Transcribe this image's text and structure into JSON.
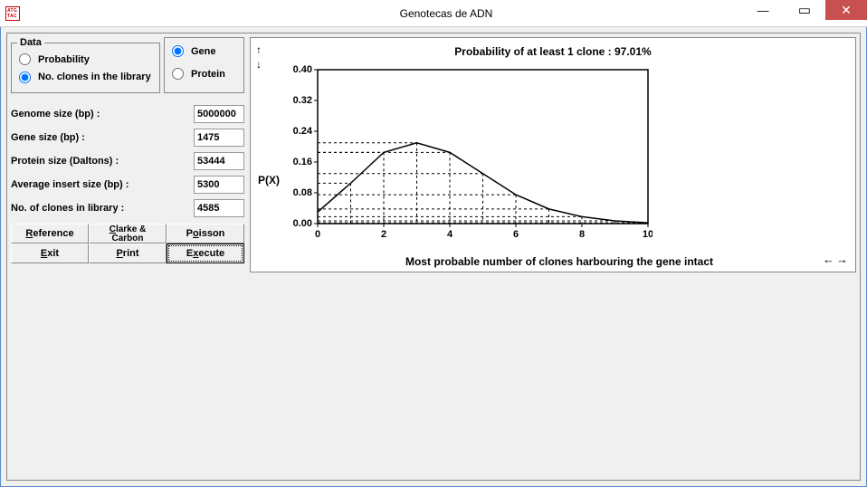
{
  "window": {
    "title": "Genotecas de ADN"
  },
  "data_group": {
    "legend": "Data",
    "opt_probability": "Probability",
    "opt_no_clones": "No.  clones in the library",
    "opt_gene": "Gene",
    "opt_protein": "Protein",
    "selected_left": "no_clones",
    "selected_right": "gene"
  },
  "fields": {
    "genome_size": {
      "label": "Genome size (bp) :",
      "value": "5000000"
    },
    "gene_size": {
      "label": "Gene size (bp) :",
      "value": "1475"
    },
    "protein_size": {
      "label": "Protein size (Daltons) :",
      "value": "53444"
    },
    "avg_insert": {
      "label": "Average insert size (bp) :",
      "value": "5300"
    },
    "no_clones": {
      "label": "No. of clones in library :",
      "value": "4585"
    }
  },
  "buttons": {
    "reference": "Reference",
    "clarke_carbon_line1": "Clarke &",
    "clarke_carbon_line2": "Carbon",
    "poisson": "Poisson",
    "exit": "Exit",
    "print": "Print",
    "execute": "Execute"
  },
  "chart_data": {
    "type": "line",
    "title": "Probability of at least 1 clone :    97.01%",
    "ylabel": "P(X)",
    "xlabel": "Most probable number of clones harbouring the gene intact",
    "x": [
      0,
      1,
      2,
      3,
      4,
      5,
      6,
      7,
      8,
      9,
      10
    ],
    "values": [
      0.03,
      0.105,
      0.185,
      0.21,
      0.185,
      0.13,
      0.075,
      0.038,
      0.018,
      0.007,
      0.002
    ],
    "ylim": [
      0.0,
      0.4
    ],
    "yticks": [
      0.0,
      0.08,
      0.16,
      0.24,
      0.32,
      0.4
    ],
    "xlim": [
      0,
      10
    ],
    "xticks": [
      0,
      2,
      4,
      6,
      8,
      10
    ]
  }
}
